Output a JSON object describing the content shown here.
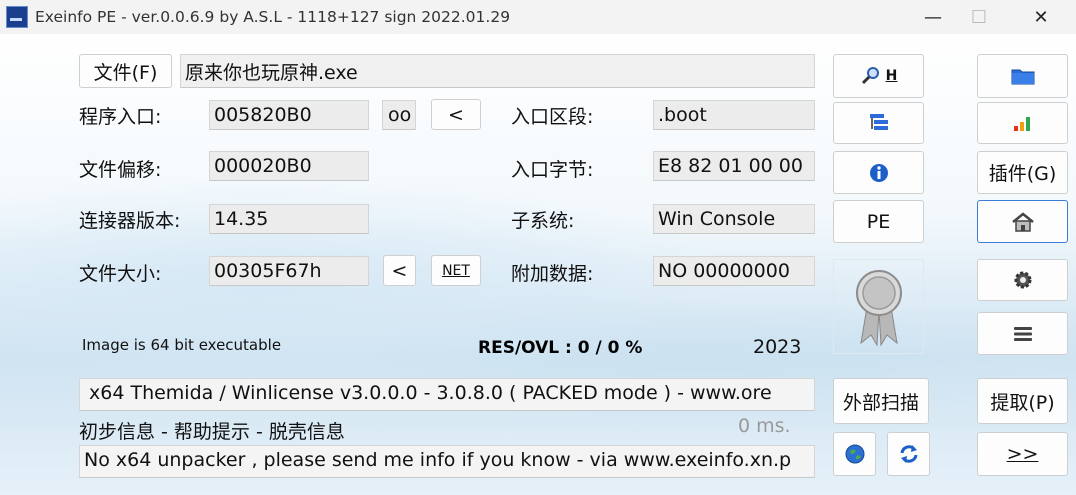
{
  "window": {
    "title": "Exeinfo PE - ver.0.0.6.9  by A.S.L -  1118+127 sign  2022.01.29"
  },
  "file": {
    "button_label": "文件(F)",
    "path": "原来你也玩原神.exe"
  },
  "fields": {
    "entry_point_label": "程序入口:",
    "entry_point": "005820B0",
    "oo_label": "oo",
    "lt_label": "<",
    "file_offset_label": "文件偏移:",
    "file_offset": "000020B0",
    "linker_label": "连接器版本:",
    "linker": "14.35",
    "file_size_label": "文件大小:",
    "file_size": "00305F67h",
    "size_lt_label": "<",
    "net_label": "NET",
    "ep_section_label": "入口区段:",
    "ep_section": ".boot",
    "ep_bytes_label": "入口字节:",
    "ep_bytes": "E8 82 01 00 00",
    "subsystem_label": "子系统:",
    "subsystem": "Win Console",
    "overlay_label": "附加数据:",
    "overlay": "NO   00000000"
  },
  "status": {
    "image_info": "Image is 64 bit executable",
    "res_ovl": "RES/OVL : 0 / 0 %",
    "year": "2023"
  },
  "detection": {
    "result": "x64 Themida / Winlicense v3.0.0.0 - 3.0.8.0 ( PACKED mode ) - www.ore",
    "time": "0 ms."
  },
  "hint": {
    "links": "初步信息 - 帮助提示 - 脱壳信息",
    "message": "No x64 unpacker , please send me info if you know - via www.exeinfo.xn.p"
  },
  "middle_buttons": {
    "h_label": "H",
    "pe_label": "PE",
    "external_scan_label": "外部扫描"
  },
  "right_buttons": {
    "plugins_label": "插件(G)",
    "extract_label": "提取(P)",
    "next_label": ">>"
  },
  "icons": [
    "search-icon",
    "list-icon",
    "info-icon",
    "award-ribbon-icon",
    "folder-icon",
    "bar-chart-icon",
    "home-icon",
    "gear-icon",
    "menu-icon",
    "globe-icon",
    "refresh-icon"
  ],
  "colors": {
    "accent": "#3a7bd5",
    "folder_blue": "#2e6bd9",
    "chart_red": "#e0301e",
    "chart_orange": "#f39c12",
    "chart_green": "#2fa84f"
  }
}
